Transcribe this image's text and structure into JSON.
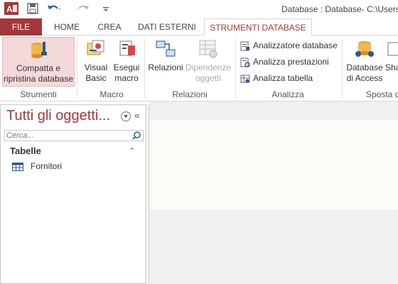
{
  "title_bar": {
    "title": "Database : Database- C:\\Users\\("
  },
  "tabs": [
    {
      "label": "FILE"
    },
    {
      "label": "HOME"
    },
    {
      "label": "CREA"
    },
    {
      "label": "DATI ESTERNI"
    },
    {
      "label": "STRUMENTI DATABASE"
    }
  ],
  "ribbon": {
    "strumenti": {
      "compact_label_1": "Compatta e",
      "compact_label_2": "ripristina database",
      "group": "Strumenti"
    },
    "macro": {
      "vb_1": "Visual",
      "vb_2": "Basic",
      "run_1": "Esegui",
      "run_2": "macro",
      "group": "Macro"
    },
    "relazioni": {
      "rel": "Relazioni",
      "dep_1": "Dipendenze",
      "dep_2": "oggetti",
      "group": "Relazioni"
    },
    "analizza": {
      "items": [
        "Analizzatore database",
        "Analizza prestazioni",
        "Analizza tabella"
      ],
      "group": "Analizza"
    },
    "sposta": {
      "db_1": "Database",
      "db_2": "di Access",
      "sha": "Sha",
      "group": "Sposta d"
    }
  },
  "nav": {
    "title": "Tutti gli oggetti...",
    "search_placeholder": "Cerca...",
    "group": "Tabelle",
    "items": [
      "Fornitori"
    ]
  },
  "colors": {
    "accent": "#a4373a",
    "highlight": "#f3d9da"
  }
}
